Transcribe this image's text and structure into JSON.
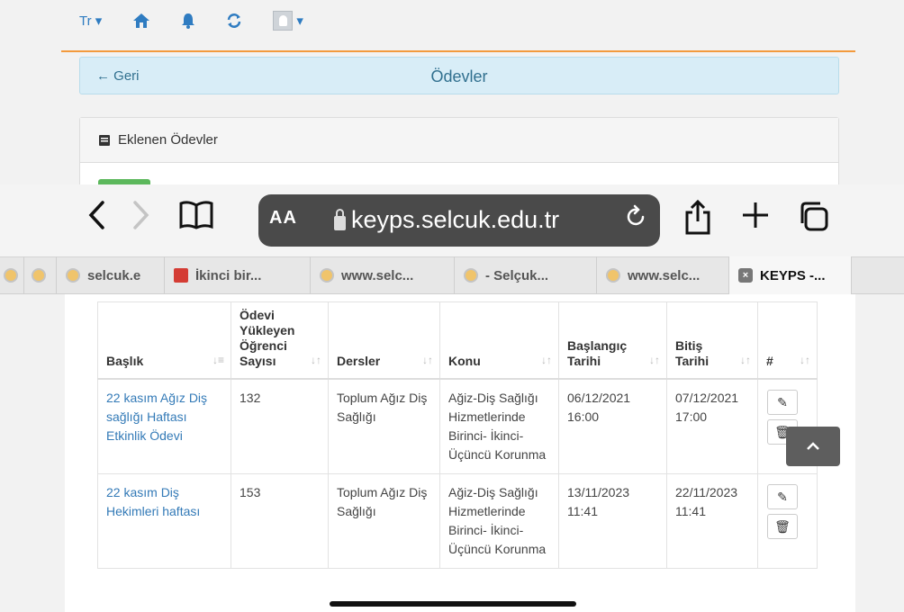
{
  "topnav": {
    "lang": "Tr ▾",
    "home_icon": "home-icon",
    "bell_icon": "bell-icon",
    "refresh_icon": "refresh-icon"
  },
  "header": {
    "back_label": "← Geri",
    "title": "Ödevler"
  },
  "panel": {
    "title": "Eklenen Ödevler"
  },
  "browser": {
    "aa_label": "AA",
    "url": "keyps.selcuk.edu.tr",
    "tabs": [
      {
        "label": "selcuk.e",
        "icon": "globe"
      },
      {
        "label": "İkinci bir...",
        "icon": "pdf"
      },
      {
        "label": "www.selc...",
        "icon": "globe"
      },
      {
        "label": "- Selçuk...",
        "icon": "globe"
      },
      {
        "label": "www.selc...",
        "icon": "globe"
      },
      {
        "label": "KEYPS -...",
        "icon": "close"
      }
    ]
  },
  "table": {
    "headers": {
      "baslik": "Başlık",
      "yukleyen": "Ödevi Yükleyen Öğrenci Sayısı",
      "dersler": "Dersler",
      "konu": "Konu",
      "baslangic": "Başlangıç Tarihi",
      "bitis": "Bitiş Tarihi",
      "hash": "#"
    },
    "rows": [
      {
        "baslik": "22 kasım Ağız Diş sağlığı Haftası Etkinlik Ödevi",
        "sayi": "132",
        "ders": "Toplum Ağız Diş Sağlığı",
        "konu": "Ağiz-Diş Sağlığı Hizmetlerinde Birinci- İkinci- Üçüncü Korunma",
        "baslangic": "06/12/2021 16:00",
        "bitis": "07/12/2021 17:00"
      },
      {
        "baslik": "22 kasım Diş Hekimleri haftası",
        "sayi": "153",
        "ders": "Toplum Ağız Diş Sağlığı",
        "konu": "Ağiz-Diş Sağlığı Hizmetlerinde Birinci- İkinci- Üçüncü Korunma",
        "baslangic": "13/11/2023 11:41",
        "bitis": "22/11/2023 11:41"
      }
    ]
  },
  "colors": {
    "link": "#337ab7",
    "header_bg": "#d8edf7",
    "accent_line": "#f39a3d",
    "success": "#5cb85c"
  }
}
